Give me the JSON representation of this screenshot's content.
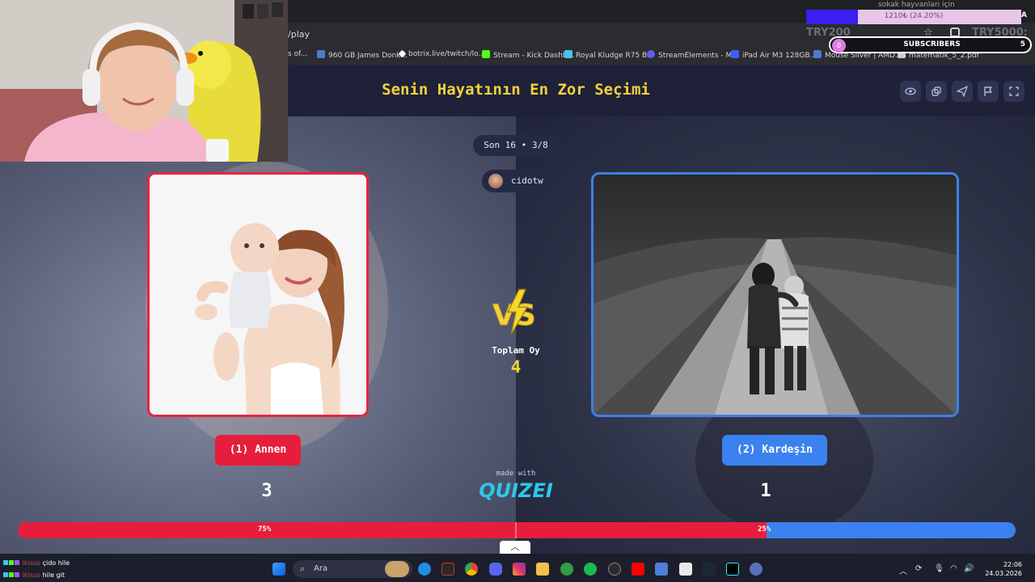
{
  "browser": {
    "url_fragment": "/play",
    "bookmarks": [
      {
        "label": "s of...",
        "icon": "bookmark-icon",
        "color": "#2b2c30"
      },
      {
        "label": "960 GB James Donk...",
        "icon": "site-h-icon",
        "color": "#4a7bd0"
      },
      {
        "label": "botrix.live/twitch/lo...",
        "icon": "botrix-icon",
        "color": "#ffffff"
      },
      {
        "label": "Stream - Kick Dashb...",
        "icon": "kick-icon",
        "color": "#53fc18"
      },
      {
        "label": "Royal Kludge R75 B...",
        "icon": "diamond-icon",
        "color": "#44c4e8"
      },
      {
        "label": "StreamElements - M...",
        "icon": "streamelements-icon",
        "color": "#5e5ef0"
      },
      {
        "label": "iPad Air M3 128GB...",
        "icon": "vatan-icon",
        "color": "#3b5cff"
      },
      {
        "label": "Mouse Silver | AMD...",
        "icon": "site-h-icon",
        "color": "#4a7bd0"
      },
      {
        "label": "matematik_5_2.pdf",
        "icon": "pdf-icon",
        "color": "#cfcfcf"
      }
    ]
  },
  "quiz": {
    "title": "Senin Hayatının En Zor Seçimi",
    "round": "Son 16 • 3/8",
    "user": "cidotw",
    "total_label": "Toplam Oy",
    "total_votes": "4",
    "made_with": "made with",
    "brand": "QUIZEI",
    "header_icons": [
      "eye-icon",
      "external-window-icon",
      "send-icon",
      "flag-icon",
      "fullscreen-icon"
    ],
    "left": {
      "label": "(1) Annen",
      "votes": "3",
      "percent_label": "75%",
      "color": "#e61e3c"
    },
    "right": {
      "label": "(2) Kardeşin",
      "votes": "1",
      "percent_label": "25%",
      "color": "#3b82f0"
    },
    "left_fraction": 0.75
  },
  "overlay": {
    "cause": "sokak hayvanları için",
    "goal_text": "1210₺ (24.20%)",
    "goal_fraction": 0.242,
    "goal_short": "A",
    "try_left": "TRY200",
    "try_right": "TRY5000:",
    "subs_label": "SUBSCRIBERS",
    "subs_current": "0",
    "subs_goal": "5"
  },
  "taskbar": {
    "chat": [
      {
        "user": "ikisus",
        "msg": "çido hile"
      },
      {
        "user": "ikisus",
        "msg": "hile git"
      }
    ],
    "search_label": "Ara",
    "time": "22:06",
    "date": "24.03.2026"
  }
}
